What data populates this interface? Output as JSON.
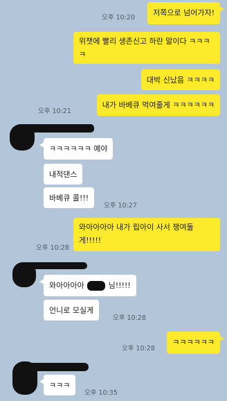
{
  "messages": [
    {
      "side": "out",
      "text": "저쪽으로 넘어가자!",
      "time": "오후 10:20"
    },
    {
      "side": "out",
      "text": "위챗에 빨리 생존신고 하란 말이다 ㅋㅋㅋㅋ",
      "time": ""
    },
    {
      "side": "out",
      "text": "대박 신났음 ㅋㅋㅋㅋ",
      "time": ""
    },
    {
      "side": "out",
      "text": "내가 바베큐 먹여줄게 ㅋㅋㅋㅋㅋㅋ",
      "time": "오후 10:21"
    },
    {
      "side": "in",
      "text": "ㅋㅋㅋㅋㅋㅋ 예야",
      "time": ""
    },
    {
      "side": "in",
      "text": "내적댄스",
      "time": ""
    },
    {
      "side": "in",
      "text": "바베큐 콜!!!",
      "time": "오후 10:27"
    },
    {
      "side": "out",
      "text": "와아아아아 내가 립아이 사서 쟁여둘게!!!!!",
      "time": "오후 10:28"
    },
    {
      "side": "in",
      "text": "와아아아아",
      "text_suffix": "님!!!!!",
      "time": ""
    },
    {
      "side": "in",
      "text": "언니로 모실게",
      "time": "오후 10:28"
    },
    {
      "side": "out",
      "text": "ㅋㅋㅋㅋㅋㅋ",
      "time": "오후 10:28"
    },
    {
      "side": "in",
      "text": "ㅋㅋㅋ",
      "time": "오후 10:35"
    }
  ],
  "colors": {
    "background": "#b3c6d9",
    "outgoing_bubble": "#fdea2b",
    "incoming_bubble": "#ffffff",
    "redaction": "#111111"
  },
  "icons": [
    "profile-avatar-redacted"
  ]
}
